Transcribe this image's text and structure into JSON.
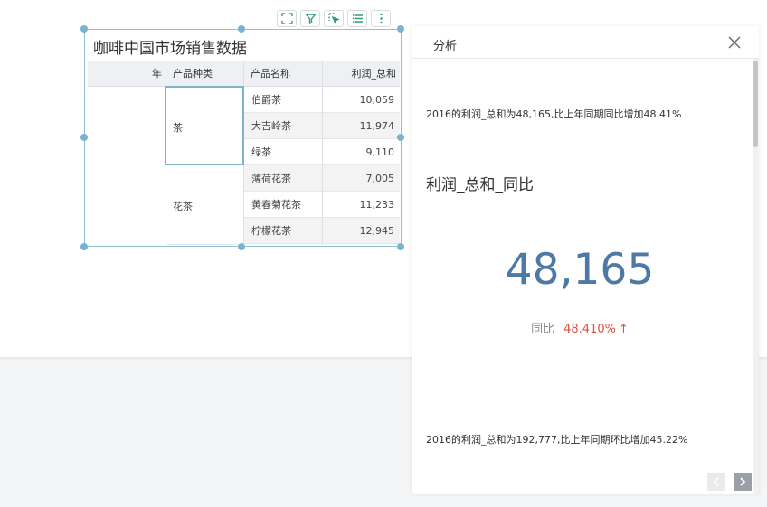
{
  "widget": {
    "title": "咖啡中国市场销售数据",
    "toolbar": [
      "expand-icon",
      "filter-icon",
      "select-icon",
      "list-icon",
      "more-icon"
    ]
  },
  "table": {
    "headers": [
      "年",
      "产品种类",
      "产品名称",
      "利润_总和"
    ],
    "groups": [
      {
        "category": "茶",
        "rows": [
          {
            "name": "伯爵茶",
            "value": "10,059"
          },
          {
            "name": "大吉岭茶",
            "value": "11,974"
          },
          {
            "name": "绿茶",
            "value": "9,110"
          }
        ]
      },
      {
        "category": "花茶",
        "rows": [
          {
            "name": "薄荷花茶",
            "value": "7,005"
          },
          {
            "name": "黄春菊花茶",
            "value": "11,233"
          },
          {
            "name": "柠檬花茶",
            "value": "12,945"
          }
        ]
      }
    ]
  },
  "panel": {
    "title": "分析",
    "insight_yoy": "2016的利润_总和为48,165,比上年同期同比增加48.41%",
    "metric_name": "利润_总和_同比",
    "big_value": "48,165",
    "compare_label": "同比",
    "compare_value": "48.410%",
    "compare_arrow": "↑",
    "insight_mom": "2016的利润_总和为192,777,比上年同期环比增加45.22%"
  },
  "colors": {
    "accent": "#4d79a4",
    "increase": "#e0533f",
    "selection": "#8fc1d8",
    "toolbar_icon": "#2e9e6b"
  }
}
